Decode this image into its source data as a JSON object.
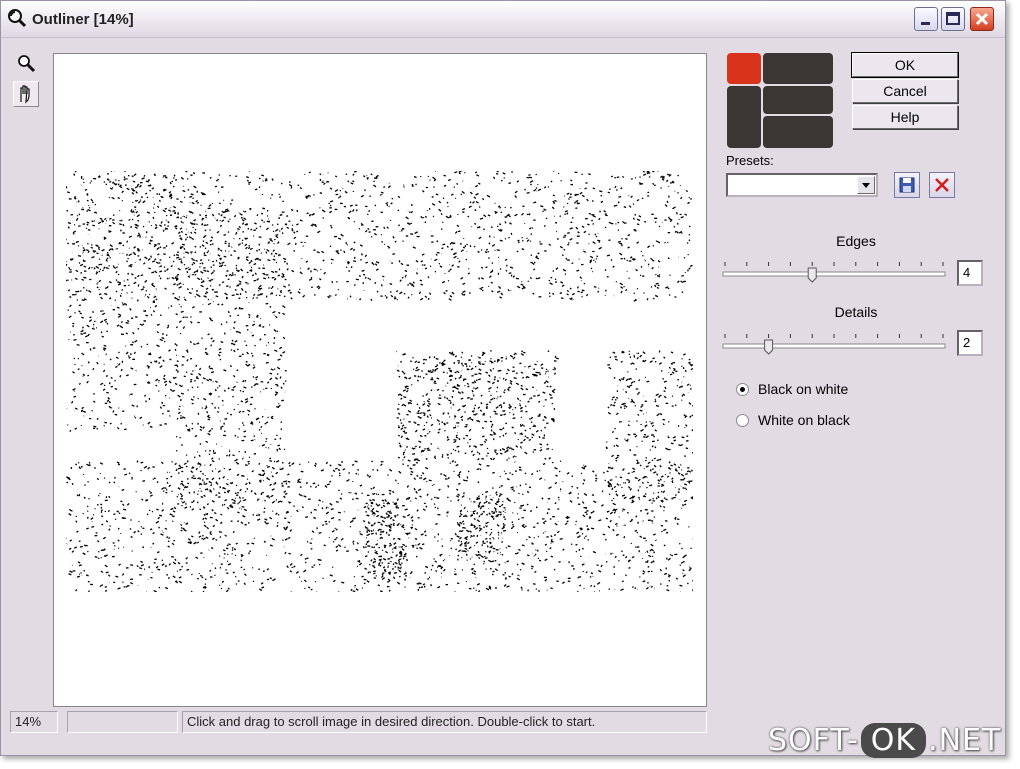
{
  "window": {
    "title": "Outliner [14%]"
  },
  "toolbar": {
    "tools": [
      "zoom-icon",
      "hand-icon"
    ]
  },
  "buttons": {
    "ok": "OK",
    "cancel": "Cancel",
    "help": "Help"
  },
  "presets": {
    "label": "Presets:",
    "value": ""
  },
  "edges": {
    "label": "Edges",
    "value": "4",
    "fraction": 0.4
  },
  "details": {
    "label": "Details",
    "value": "2",
    "fraction": 0.2
  },
  "mode": {
    "options": [
      "Black on white",
      "White on black"
    ],
    "selected": "Black on white"
  },
  "status": {
    "zoom": "14%",
    "blank": "",
    "message": "Click and drag to scroll image in desired direction. Double-click to start."
  },
  "watermark": {
    "left": "SOFT-",
    "pill": "OK",
    "right": ".NET"
  },
  "colors": {
    "window_bg": "#e3dbe3",
    "logo_red": "#d9331c",
    "logo_dark": "#3b3633",
    "close_red": "#d43e22"
  }
}
